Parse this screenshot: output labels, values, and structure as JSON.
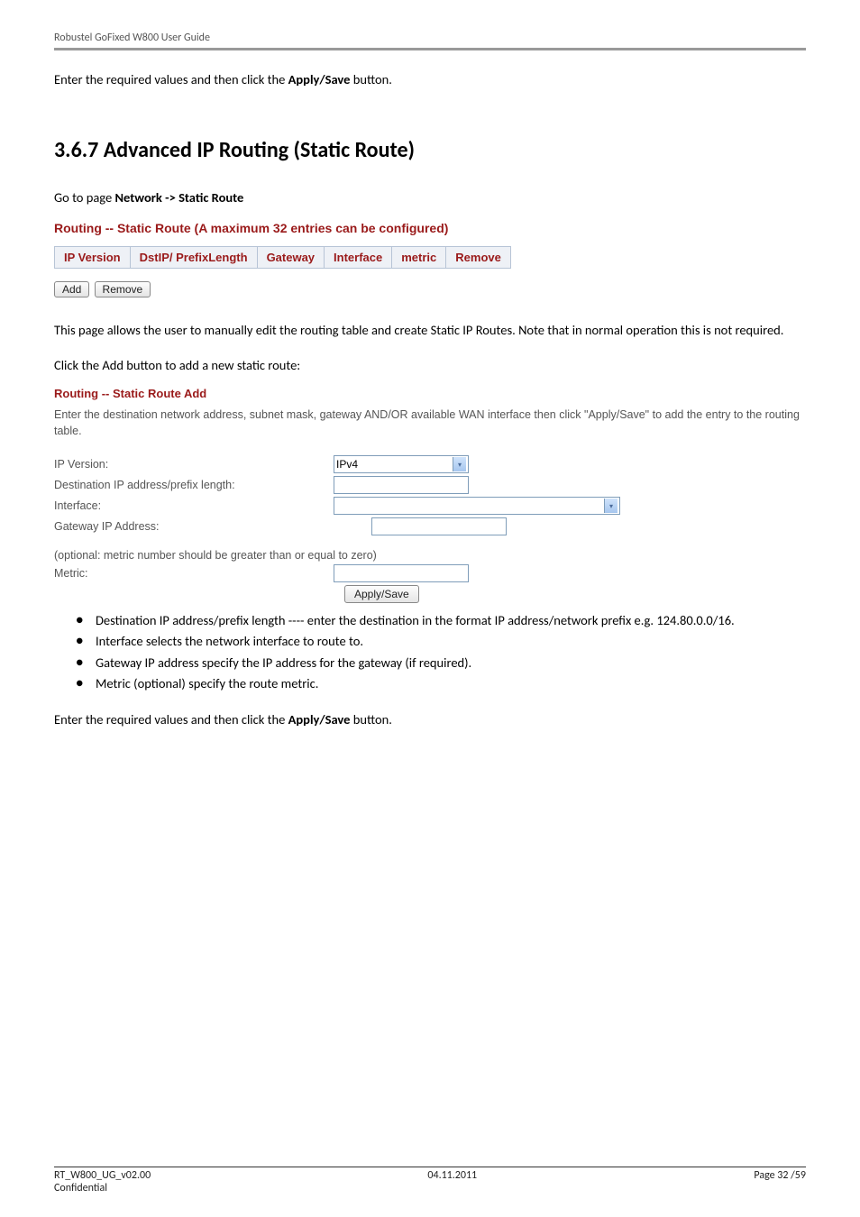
{
  "header": {
    "doc_title": "Robustel GoFixed W800 User Guide"
  },
  "intro1": {
    "pre": "Enter the required values and then click the ",
    "bold": "Apply/Save",
    "post": " button."
  },
  "section_heading": "3.6.7 Advanced IP Routing (Static Route)",
  "goto": {
    "pre": "Go to page ",
    "bold": "Network -> Static Route"
  },
  "img1": {
    "title": "Routing -- Static Route (A maximum 32 entries can be configured)",
    "cols": [
      "IP Version",
      "DstIP/ PrefixLength",
      "Gateway",
      "Interface",
      "metric",
      "Remove"
    ],
    "btn_add": "Add",
    "btn_remove": "Remove"
  },
  "para_after_img1": "This page allows the user to manually edit the routing table and create Static IP Routes. Note that in normal operation this is not required.",
  "para_click_add": "Click the Add button to add a new static route:",
  "img2": {
    "title": "Routing -- Static Route Add",
    "desc": "Enter the destination network address, subnet mask, gateway AND/OR available WAN interface then click \"Apply/Save\" to add the entry to the routing table.",
    "labels": {
      "ip_version": "IP Version:",
      "dest": "Destination IP address/prefix length:",
      "interface": "Interface:",
      "gateway": "Gateway IP Address:",
      "optional": "(optional: metric number should be greater than or equal to zero)",
      "metric": "Metric:"
    },
    "ip_version_value": "IPv4",
    "btn_apply": "Apply/Save"
  },
  "bullets": {
    "b1": "Destination IP address/prefix length ---- enter the destination in the format IP address/network prefix e.g. 124.80.0.0/16.",
    "b2": "Interface selects the network interface to route to.",
    "b3": "Gateway IP address specify the IP address for the gateway (if required).",
    "b4": "Metric (optional) specify the route metric."
  },
  "outro": {
    "pre": "Enter the required values and then click the ",
    "bold": "Apply/Save",
    "post": " button."
  },
  "footer": {
    "left1": "RT_W800_UG_v02.00",
    "left2": "Confidential",
    "center": "04.11.2011",
    "right": "Page 32 /59"
  }
}
